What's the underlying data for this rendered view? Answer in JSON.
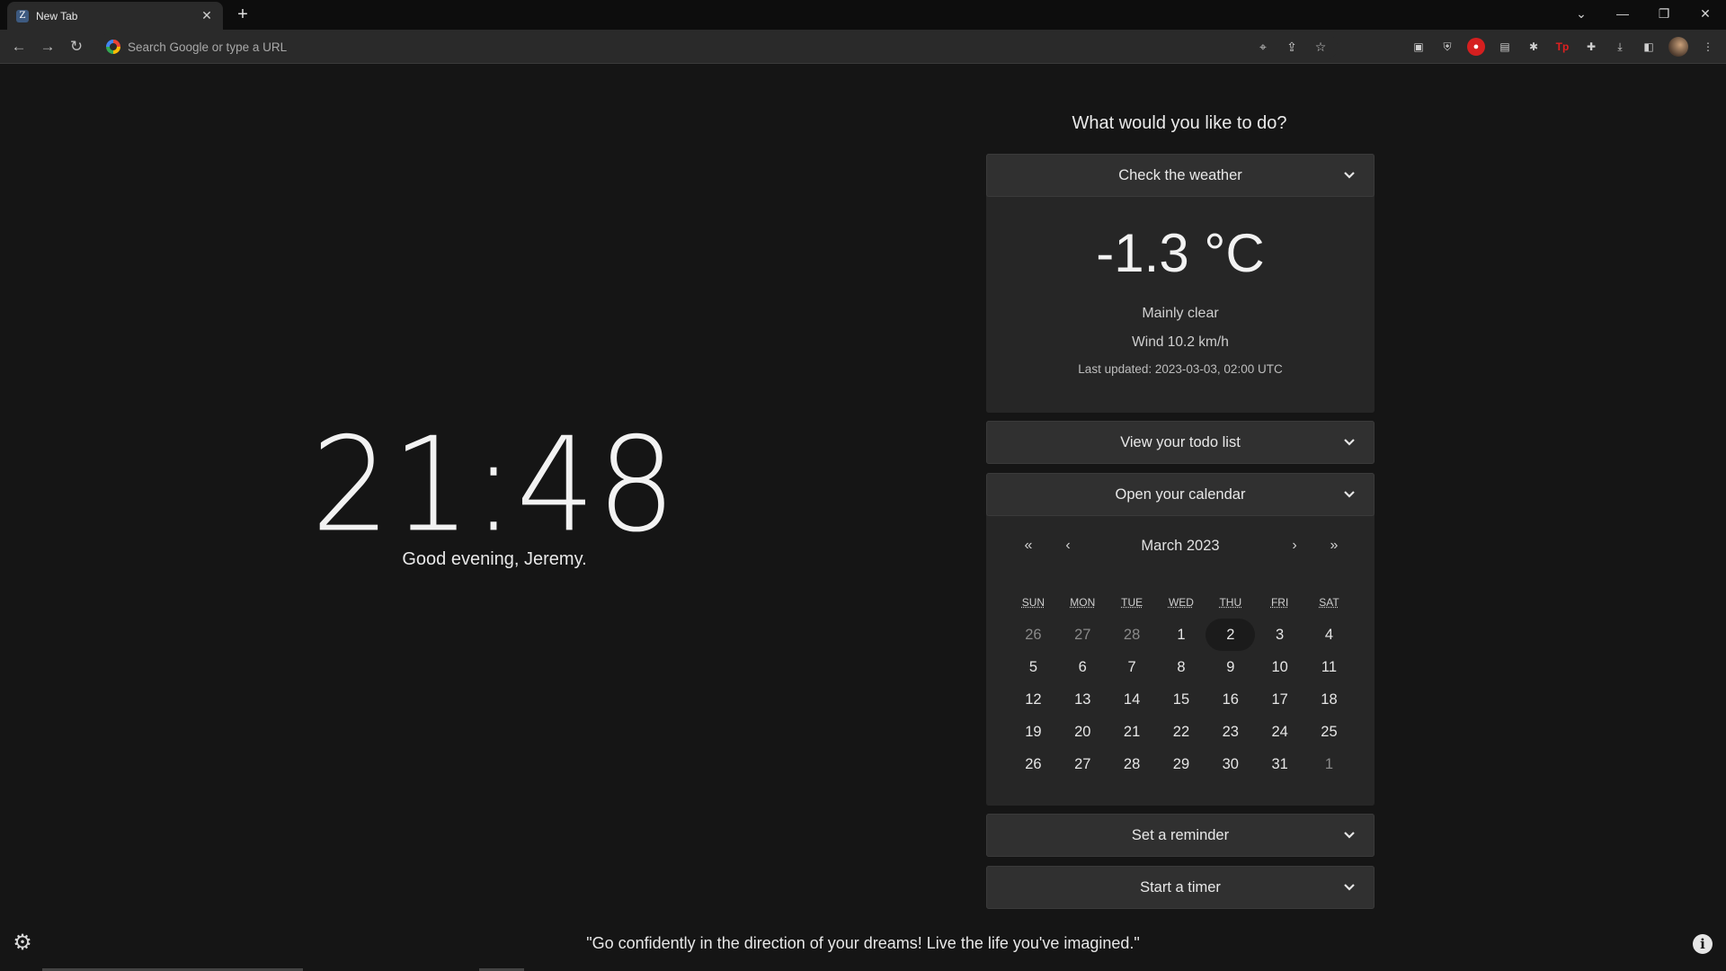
{
  "browser": {
    "tab": {
      "title": "New Tab",
      "favicon": "Z"
    },
    "new_tab": "+",
    "omnibox_placeholder": "Search Google or type a URL"
  },
  "clock": {
    "time": "21:48",
    "greeting": "Good evening, Jeremy."
  },
  "panel": {
    "title": "What would you like to do?",
    "weather": {
      "label": "Check the weather",
      "temp": "-1.3 °C",
      "condition": "Mainly clear",
      "wind": "Wind  10.2 km/h",
      "updated": "Last updated:  2023-03-03, 02:00 UTC"
    },
    "todo": {
      "label": "View your todo list"
    },
    "calendar": {
      "label": "Open your calendar",
      "month": "March 2023",
      "nav": {
        "prev_year": "«",
        "prev_month": "‹",
        "next_month": "›",
        "next_year": "»"
      },
      "weekdays": [
        "SUN",
        "MON",
        "TUE",
        "WED",
        "THU",
        "FRI",
        "SAT"
      ],
      "weeks": [
        [
          "26",
          "27",
          "28",
          "1",
          "2",
          "3",
          "4"
        ],
        [
          "5",
          "6",
          "7",
          "8",
          "9",
          "10",
          "11"
        ],
        [
          "12",
          "13",
          "14",
          "15",
          "16",
          "17",
          "18"
        ],
        [
          "19",
          "20",
          "21",
          "22",
          "23",
          "24",
          "25"
        ],
        [
          "26",
          "27",
          "28",
          "29",
          "30",
          "31",
          "1"
        ]
      ],
      "today": "2"
    },
    "reminder": {
      "label": "Set a reminder"
    },
    "timer": {
      "label": "Start a timer"
    }
  },
  "quote": "\"Go confidently in the direction of your dreams! Live the life you've imagined.\""
}
